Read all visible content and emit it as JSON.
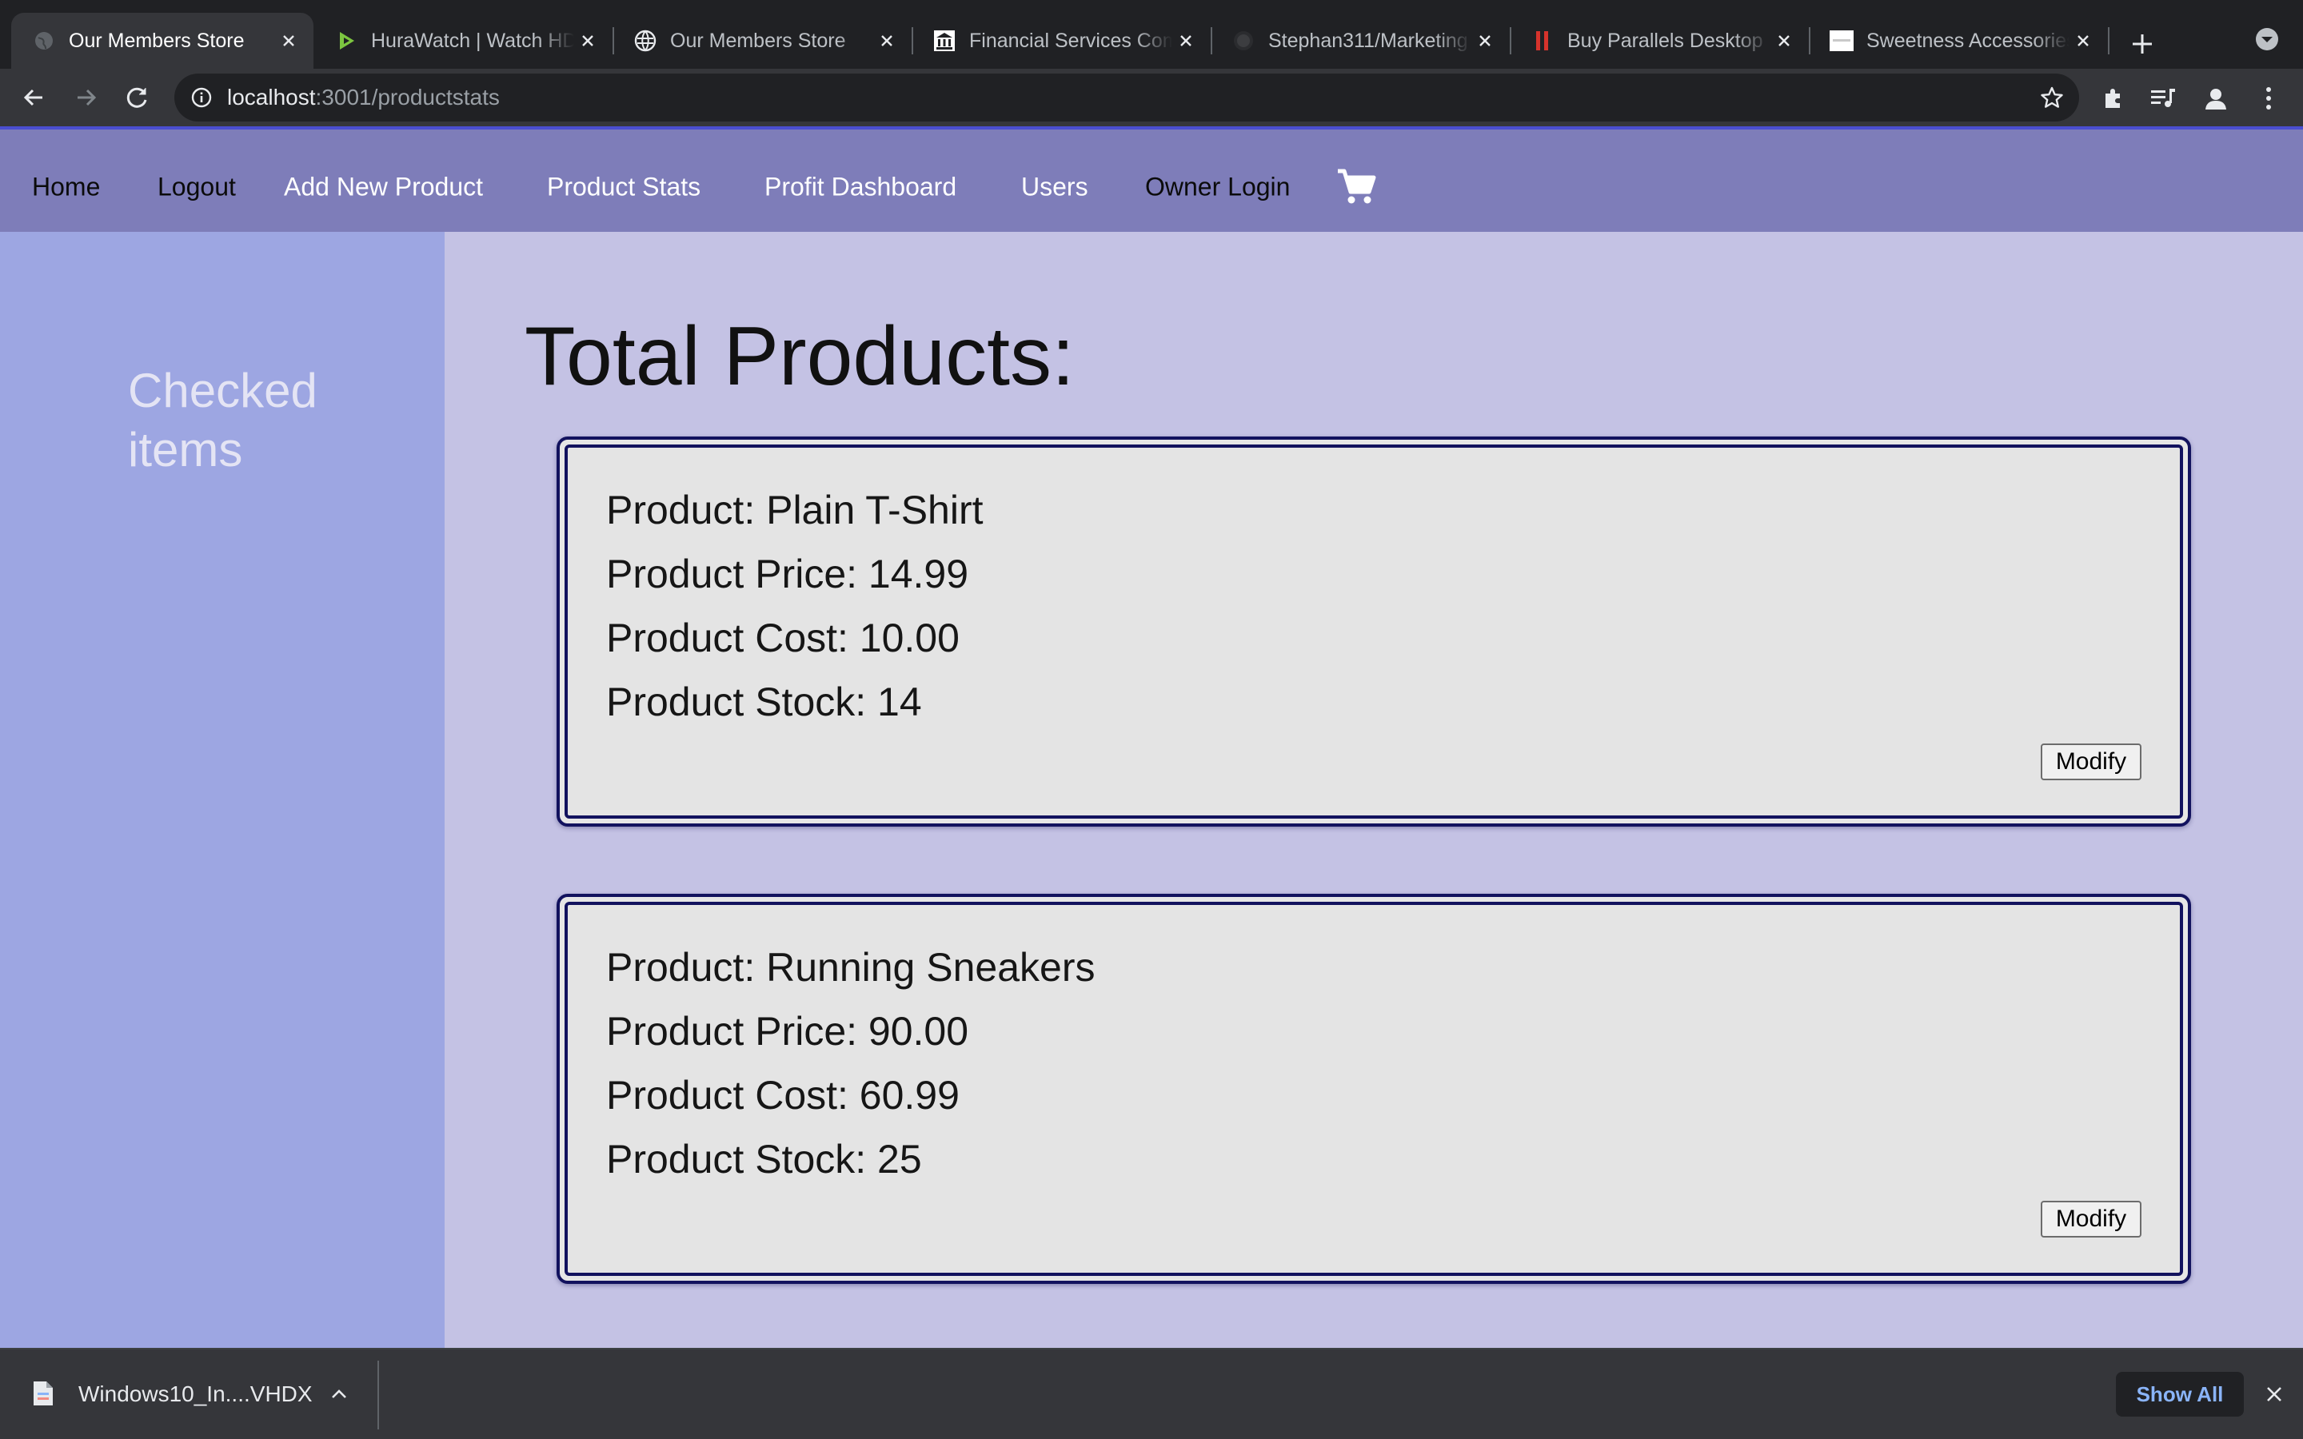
{
  "browser": {
    "tabs": [
      {
        "title": "Our Members Store",
        "icon": "globe-icon",
        "active": true
      },
      {
        "title": "HuraWatch | Watch HD Movies",
        "icon": "play-icon",
        "active": false
      },
      {
        "title": "Our Members Store",
        "icon": "globe-icon",
        "active": false
      },
      {
        "title": "Financial Services Company",
        "icon": "bank-icon",
        "active": false
      },
      {
        "title": "Stephan311/Marketing",
        "icon": "github-icon",
        "active": false
      },
      {
        "title": "Buy Parallels Desktop",
        "icon": "parallels-icon",
        "active": false
      },
      {
        "title": "Sweetness Accessories",
        "icon": "page-icon",
        "active": false
      }
    ],
    "url": {
      "host": "localhost",
      "path": ":3001/productstats"
    }
  },
  "navbar": {
    "links": [
      "Home",
      "Logout",
      "Add New Product",
      "Product Stats",
      "Profit Dashboard",
      "Users",
      "Owner Login"
    ],
    "cart_icon": "cart-icon"
  },
  "sidebar": {
    "title": "Checked items"
  },
  "main": {
    "title": "Total Products:",
    "products": [
      {
        "product": "Product: Plain T-Shirt",
        "price": "Product Price: 14.99",
        "cost": "Product Cost: 10.00",
        "stock": "Product Stock: 14",
        "button": "Modify"
      },
      {
        "product": "Product: Running Sneakers",
        "price": "Product Price: 90.00",
        "cost": "Product Cost: 60.99",
        "stock": "Product Stock: 25",
        "button": "Modify"
      }
    ]
  },
  "downloads": {
    "file_name": "Windows10_In....VHDX",
    "show_all": "Show All"
  },
  "colors": {
    "navbar": "#7e7db9",
    "sidebar": "#9da6e2",
    "content": "#c4c2e4",
    "card_border": "#12125e"
  }
}
